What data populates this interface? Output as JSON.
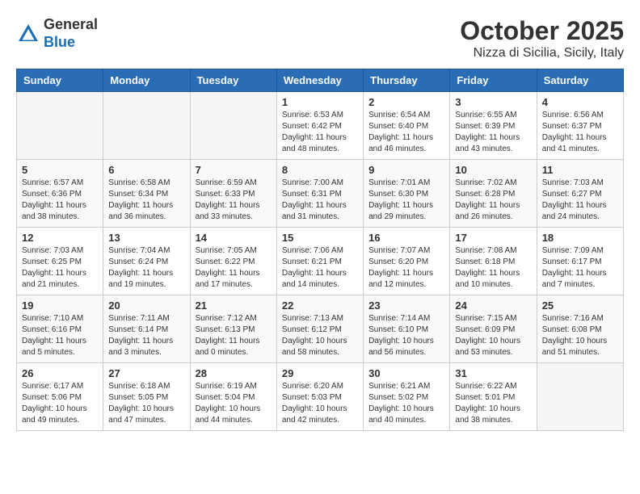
{
  "header": {
    "logo_line1": "General",
    "logo_line2": "Blue",
    "title": "October 2025",
    "subtitle": "Nizza di Sicilia, Sicily, Italy"
  },
  "calendar": {
    "weekdays": [
      "Sunday",
      "Monday",
      "Tuesday",
      "Wednesday",
      "Thursday",
      "Friday",
      "Saturday"
    ],
    "weeks": [
      [
        {
          "day": "",
          "info": ""
        },
        {
          "day": "",
          "info": ""
        },
        {
          "day": "",
          "info": ""
        },
        {
          "day": "1",
          "info": "Sunrise: 6:53 AM\nSunset: 6:42 PM\nDaylight: 11 hours\nand 48 minutes."
        },
        {
          "day": "2",
          "info": "Sunrise: 6:54 AM\nSunset: 6:40 PM\nDaylight: 11 hours\nand 46 minutes."
        },
        {
          "day": "3",
          "info": "Sunrise: 6:55 AM\nSunset: 6:39 PM\nDaylight: 11 hours\nand 43 minutes."
        },
        {
          "day": "4",
          "info": "Sunrise: 6:56 AM\nSunset: 6:37 PM\nDaylight: 11 hours\nand 41 minutes."
        }
      ],
      [
        {
          "day": "5",
          "info": "Sunrise: 6:57 AM\nSunset: 6:36 PM\nDaylight: 11 hours\nand 38 minutes."
        },
        {
          "day": "6",
          "info": "Sunrise: 6:58 AM\nSunset: 6:34 PM\nDaylight: 11 hours\nand 36 minutes."
        },
        {
          "day": "7",
          "info": "Sunrise: 6:59 AM\nSunset: 6:33 PM\nDaylight: 11 hours\nand 33 minutes."
        },
        {
          "day": "8",
          "info": "Sunrise: 7:00 AM\nSunset: 6:31 PM\nDaylight: 11 hours\nand 31 minutes."
        },
        {
          "day": "9",
          "info": "Sunrise: 7:01 AM\nSunset: 6:30 PM\nDaylight: 11 hours\nand 29 minutes."
        },
        {
          "day": "10",
          "info": "Sunrise: 7:02 AM\nSunset: 6:28 PM\nDaylight: 11 hours\nand 26 minutes."
        },
        {
          "day": "11",
          "info": "Sunrise: 7:03 AM\nSunset: 6:27 PM\nDaylight: 11 hours\nand 24 minutes."
        }
      ],
      [
        {
          "day": "12",
          "info": "Sunrise: 7:03 AM\nSunset: 6:25 PM\nDaylight: 11 hours\nand 21 minutes."
        },
        {
          "day": "13",
          "info": "Sunrise: 7:04 AM\nSunset: 6:24 PM\nDaylight: 11 hours\nand 19 minutes."
        },
        {
          "day": "14",
          "info": "Sunrise: 7:05 AM\nSunset: 6:22 PM\nDaylight: 11 hours\nand 17 minutes."
        },
        {
          "day": "15",
          "info": "Sunrise: 7:06 AM\nSunset: 6:21 PM\nDaylight: 11 hours\nand 14 minutes."
        },
        {
          "day": "16",
          "info": "Sunrise: 7:07 AM\nSunset: 6:20 PM\nDaylight: 11 hours\nand 12 minutes."
        },
        {
          "day": "17",
          "info": "Sunrise: 7:08 AM\nSunset: 6:18 PM\nDaylight: 11 hours\nand 10 minutes."
        },
        {
          "day": "18",
          "info": "Sunrise: 7:09 AM\nSunset: 6:17 PM\nDaylight: 11 hours\nand 7 minutes."
        }
      ],
      [
        {
          "day": "19",
          "info": "Sunrise: 7:10 AM\nSunset: 6:16 PM\nDaylight: 11 hours\nand 5 minutes."
        },
        {
          "day": "20",
          "info": "Sunrise: 7:11 AM\nSunset: 6:14 PM\nDaylight: 11 hours\nand 3 minutes."
        },
        {
          "day": "21",
          "info": "Sunrise: 7:12 AM\nSunset: 6:13 PM\nDaylight: 11 hours\nand 0 minutes."
        },
        {
          "day": "22",
          "info": "Sunrise: 7:13 AM\nSunset: 6:12 PM\nDaylight: 10 hours\nand 58 minutes."
        },
        {
          "day": "23",
          "info": "Sunrise: 7:14 AM\nSunset: 6:10 PM\nDaylight: 10 hours\nand 56 minutes."
        },
        {
          "day": "24",
          "info": "Sunrise: 7:15 AM\nSunset: 6:09 PM\nDaylight: 10 hours\nand 53 minutes."
        },
        {
          "day": "25",
          "info": "Sunrise: 7:16 AM\nSunset: 6:08 PM\nDaylight: 10 hours\nand 51 minutes."
        }
      ],
      [
        {
          "day": "26",
          "info": "Sunrise: 6:17 AM\nSunset: 5:06 PM\nDaylight: 10 hours\nand 49 minutes."
        },
        {
          "day": "27",
          "info": "Sunrise: 6:18 AM\nSunset: 5:05 PM\nDaylight: 10 hours\nand 47 minutes."
        },
        {
          "day": "28",
          "info": "Sunrise: 6:19 AM\nSunset: 5:04 PM\nDaylight: 10 hours\nand 44 minutes."
        },
        {
          "day": "29",
          "info": "Sunrise: 6:20 AM\nSunset: 5:03 PM\nDaylight: 10 hours\nand 42 minutes."
        },
        {
          "day": "30",
          "info": "Sunrise: 6:21 AM\nSunset: 5:02 PM\nDaylight: 10 hours\nand 40 minutes."
        },
        {
          "day": "31",
          "info": "Sunrise: 6:22 AM\nSunset: 5:01 PM\nDaylight: 10 hours\nand 38 minutes."
        },
        {
          "day": "",
          "info": ""
        }
      ]
    ]
  }
}
